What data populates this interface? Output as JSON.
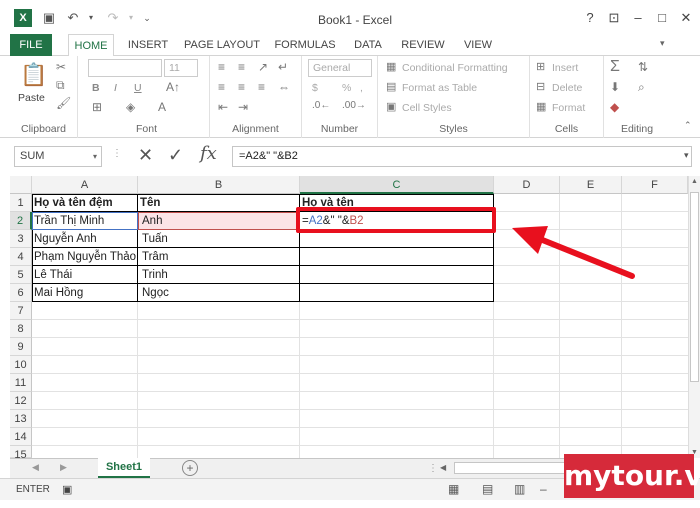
{
  "window": {
    "title": "Book1 - Excel"
  },
  "tabs": [
    "FILE",
    "HOME",
    "INSERT",
    "PAGE LAYOUT",
    "FORMULAS",
    "DATA",
    "REVIEW",
    "VIEW"
  ],
  "ribbon": {
    "clipboard": {
      "label": "Clipboard",
      "paste": "Paste"
    },
    "font": {
      "label": "Font",
      "size": "11",
      "bold": "B",
      "italic": "I",
      "underline": "U"
    },
    "alignment": {
      "label": "Alignment"
    },
    "number": {
      "label": "Number",
      "format": "General",
      "currency": "$",
      "percent": "%",
      "comma": ","
    },
    "styles": {
      "label": "Styles",
      "conditional": "Conditional Formatting",
      "table": "Format as Table",
      "cell": "Cell Styles"
    },
    "cells": {
      "label": "Cells",
      "insert": "Insert",
      "delete": "Delete",
      "format": "Format"
    },
    "editing": {
      "label": "Editing"
    }
  },
  "namebox": "SUM",
  "formula": "=A2&\" \"&B2",
  "columns": [
    "A",
    "B",
    "C",
    "D",
    "E",
    "F"
  ],
  "rows": [
    "1",
    "2",
    "3",
    "4",
    "5",
    "6",
    "7",
    "8",
    "9",
    "10",
    "11",
    "12",
    "13",
    "14",
    "15"
  ],
  "cells": {
    "a1": "Họ và tên đệm",
    "b1": "Tên",
    "c1": "Họ và tên",
    "a2": "Trần Thị Minh",
    "b2": "Anh",
    "a3": "Nguyễn Anh",
    "b3": "Tuấn",
    "a4": "Phạm Nguyễn Thảo",
    "b4": "Trâm",
    "a5": "Lê Thái",
    "b5": "Trinh",
    "a6": "Mai Hồng",
    "b6": "Ngọc"
  },
  "c2_formula": {
    "eq": "=",
    "ref1": "A2",
    "mid": "&\" \"&",
    "ref2": "B2"
  },
  "sheet": "Sheet1",
  "status": "ENTER",
  "watermark": "mytour.vn",
  "colors": {
    "excel_green": "#217346",
    "highlight_red": "#e8101e",
    "ref_blue": "#4472c4",
    "ref_red": "#c0504d"
  }
}
